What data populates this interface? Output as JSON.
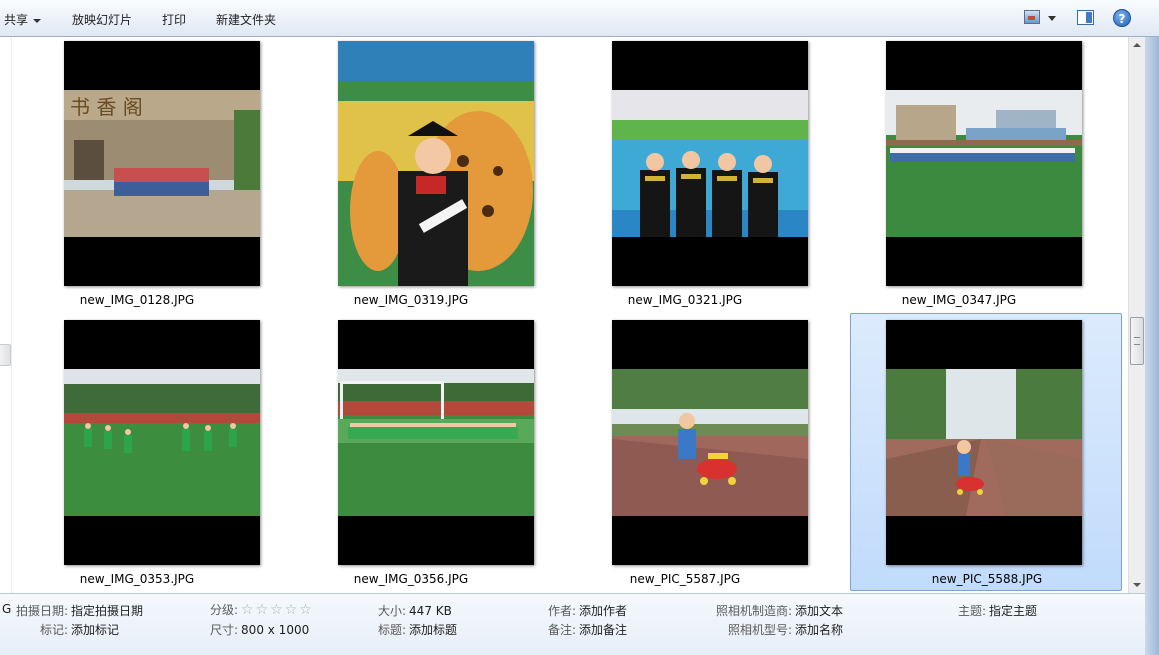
{
  "toolbar": {
    "share_label": "共享",
    "slideshow_label": "放映幻灯片",
    "print_label": "打印",
    "new_folder_label": "新建文件夹",
    "help_glyph": "?"
  },
  "files": [
    {
      "name": "new_IMG_0128.JPG"
    },
    {
      "name": "new_IMG_0319.JPG"
    },
    {
      "name": "new_IMG_0321.JPG"
    },
    {
      "name": "new_IMG_0347.JPG"
    },
    {
      "name": "new_IMG_0353.JPG"
    },
    {
      "name": "new_IMG_0356.JPG"
    },
    {
      "name": "new_PIC_5587.JPG"
    },
    {
      "name": "new_PIC_5588.JPG",
      "selected": true
    }
  ],
  "details": {
    "type_fragment": "G",
    "date_taken_label": "拍摄日期:",
    "date_taken_value": "指定拍摄日期",
    "tags_label": "标记:",
    "tags_value": "添加标记",
    "rating_label": "分级:",
    "rating_stars": "☆☆☆☆☆",
    "rating_value": 0,
    "dimensions_label": "尺寸:",
    "dimensions_value": "800 x 1000",
    "size_label": "大小:",
    "size_value": "447 KB",
    "title_label": "标题:",
    "title_value": "添加标题",
    "author_label": "作者:",
    "author_value": "添加作者",
    "comments_label": "备注:",
    "comments_value": "添加备注",
    "camera_maker_label": "照相机制造商:",
    "camera_maker_value": "添加文本",
    "camera_model_label": "照相机型号:",
    "camera_model_value": "添加名称",
    "subject_label": "主题:",
    "subject_value": "指定主题"
  },
  "colors": {
    "selection_bg": "#c1dbfc",
    "selection_border": "#7da2ce",
    "toolbar_bg": "#eef3fa"
  }
}
